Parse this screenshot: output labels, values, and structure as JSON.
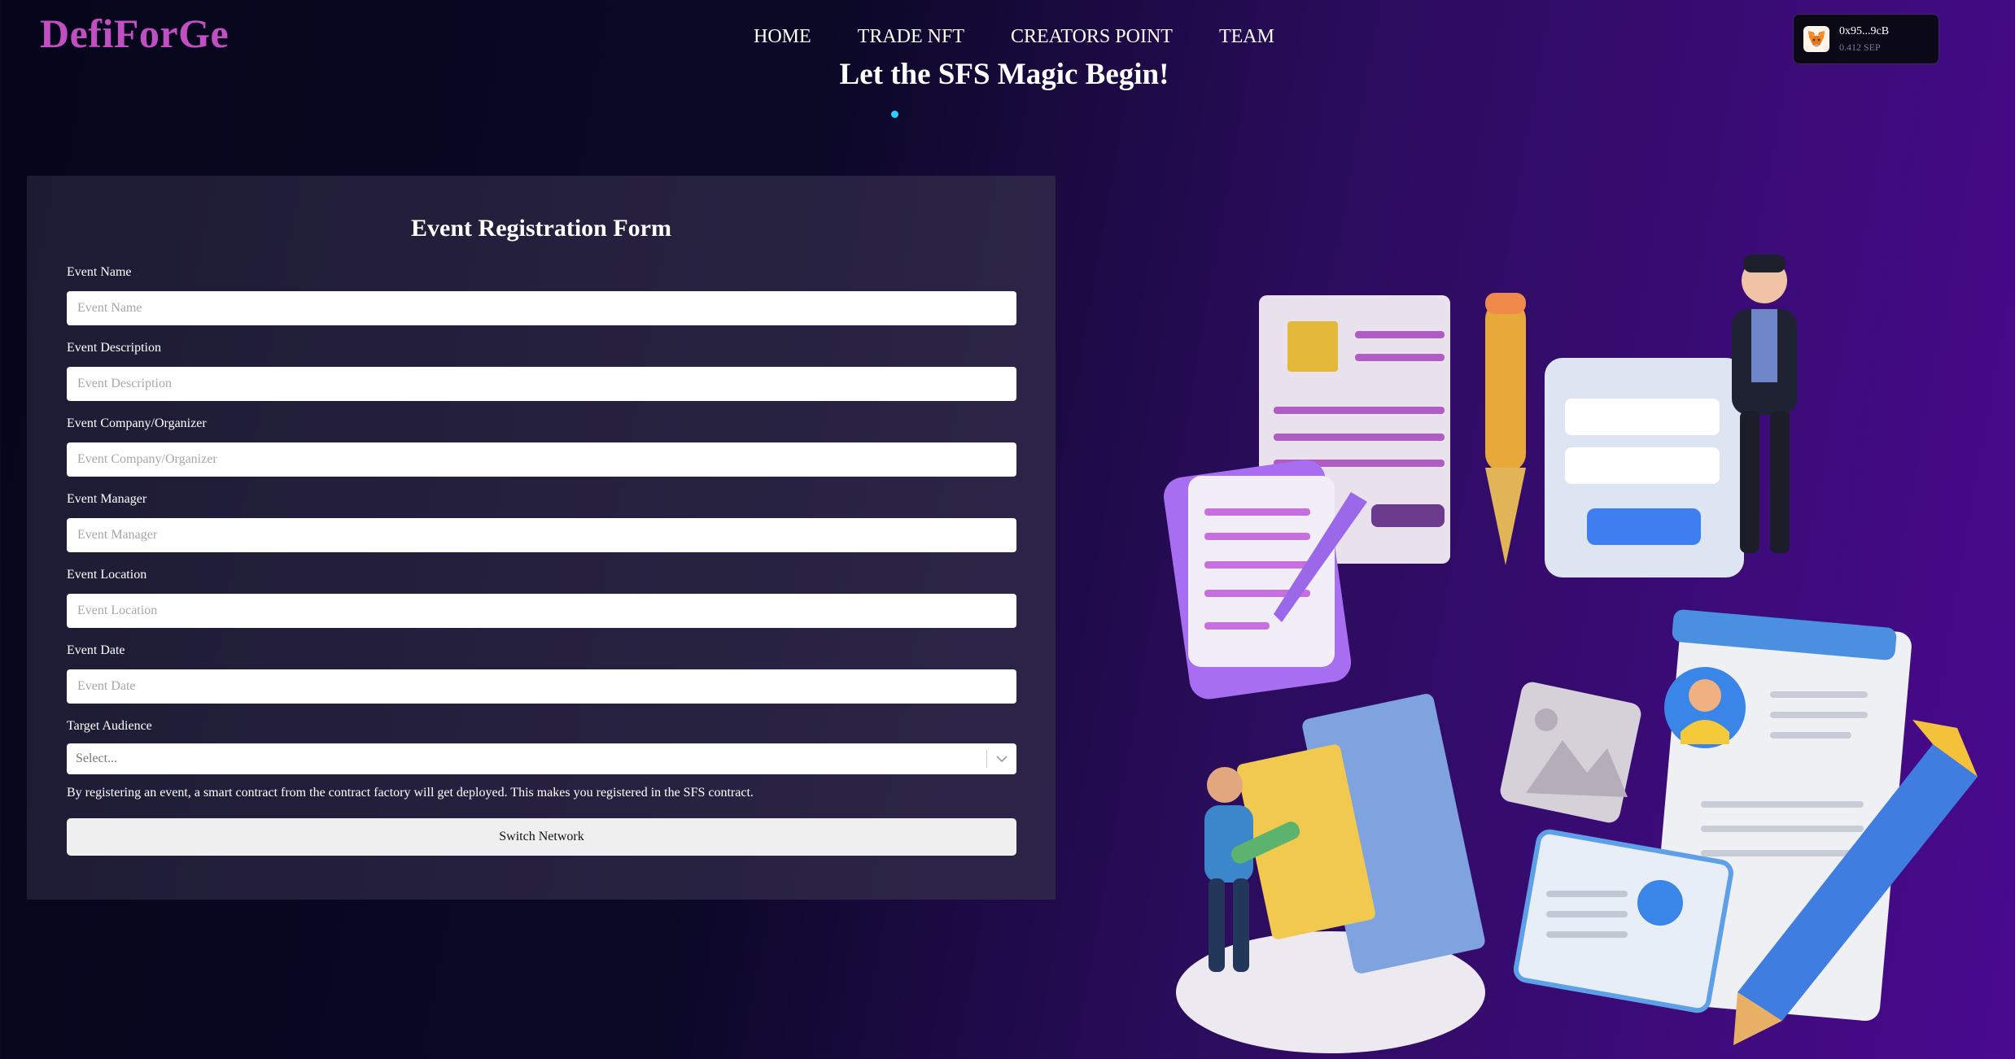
{
  "header": {
    "logo": "DefiForGe",
    "nav": [
      "HOME",
      "TRADE NFT",
      "CREATORS POINT",
      "TEAM"
    ],
    "hero_title": "Let the SFS Magic Begin!"
  },
  "wallet": {
    "address": "0x95...9cB",
    "balance": "0.412 SEP"
  },
  "form": {
    "title": "Event Registration Form",
    "fields": [
      {
        "label": "Event Name",
        "placeholder": "Event Name"
      },
      {
        "label": "Event Description",
        "placeholder": "Event Description"
      },
      {
        "label": "Event Company/Organizer",
        "placeholder": "Event Company/Organizer"
      },
      {
        "label": "Event Manager",
        "placeholder": "Event Manager"
      },
      {
        "label": "Event Location",
        "placeholder": "Event Location"
      },
      {
        "label": "Event Date",
        "placeholder": "Event Date"
      }
    ],
    "audience_label": "Target Audience",
    "audience_value": "Select...",
    "note": "By registering an event, a smart contract from the contract factory will get deployed. This makes you registered in the SFS contract.",
    "submit_label": "Switch Network"
  },
  "colors": {
    "logo": "#c24fc1",
    "accent_dot": "#29d1ff",
    "background_start": "#05061a",
    "background_end": "#4a0a8f"
  }
}
